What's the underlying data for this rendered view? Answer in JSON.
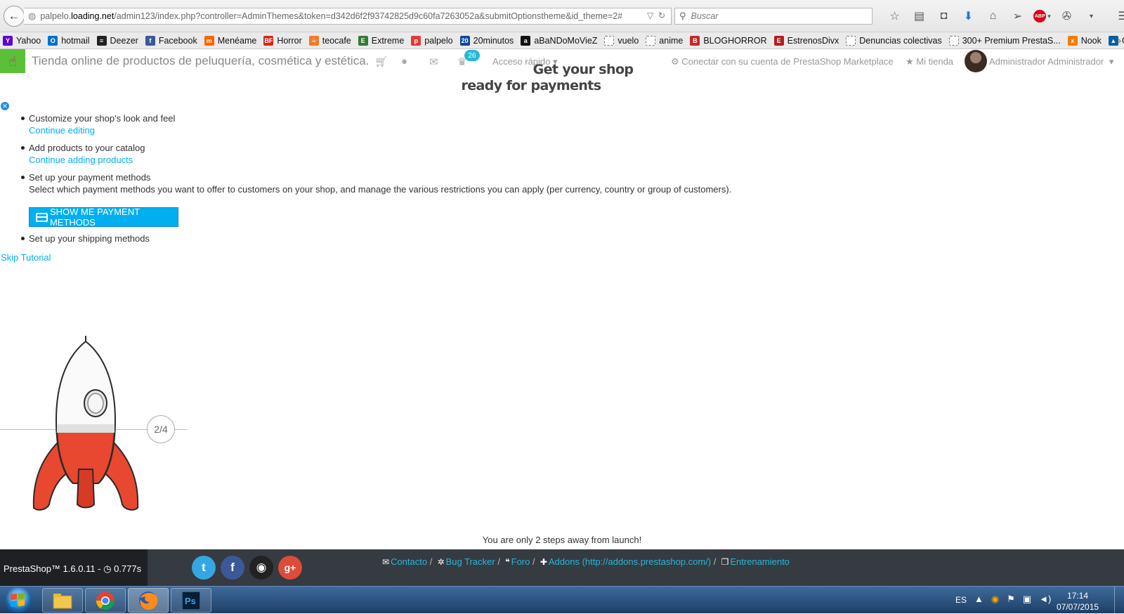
{
  "browser": {
    "url_prefix": "palpelo.",
    "url_host": "loading.net",
    "url_path": "/admin123/index.php?controller=AdminThemes&token=d342d6f2f93742825d9c60fa7263052a&submitOptionstheme&id_theme=2#",
    "search_placeholder": "Buscar"
  },
  "bookmarks": [
    {
      "label": "Yahoo",
      "icon": "yahoo-icon",
      "color": "#5f01d1",
      "glyph": "Y"
    },
    {
      "label": "hotmail",
      "icon": "outlook-icon",
      "color": "#0072c6",
      "glyph": "O"
    },
    {
      "label": "Deezer",
      "icon": "deezer-icon",
      "color": "#222222",
      "glyph": "≡"
    },
    {
      "label": "Facebook",
      "icon": "facebook-icon",
      "color": "#3b5998",
      "glyph": "f"
    },
    {
      "label": "Menéame",
      "icon": "meneame-icon",
      "color": "#ff6400",
      "glyph": "m"
    },
    {
      "label": "Horror",
      "icon": "horror-icon",
      "color": "#d9241c",
      "glyph": "BF"
    },
    {
      "label": "teocafe",
      "icon": "teocafe-icon",
      "color": "#f07a2a",
      "glyph": "☕"
    },
    {
      "label": "Extreme",
      "icon": "extreme-icon",
      "color": "#2e7d32",
      "glyph": "E"
    },
    {
      "label": "palpelo",
      "icon": "palpelo-icon",
      "color": "#e53935",
      "glyph": "p"
    },
    {
      "label": "20minutos",
      "icon": "20minutos-icon",
      "color": "#0d47a1",
      "glyph": "20"
    },
    {
      "label": "aBaNDoMoVieZ",
      "icon": "abandomoviez-icon",
      "color": "#111111",
      "glyph": "a"
    },
    {
      "label": "vuelo",
      "icon": "page-icon",
      "color": "#ffffff",
      "glyph": ""
    },
    {
      "label": "anime",
      "icon": "page-icon",
      "color": "#ffffff",
      "glyph": ""
    },
    {
      "label": "BLOGHORROR",
      "icon": "bloghorror-icon",
      "color": "#c62828",
      "glyph": "B"
    },
    {
      "label": "EstrenosDivx",
      "icon": "estrenosdivx-icon",
      "color": "#b71c1c",
      "glyph": "E"
    },
    {
      "label": "Denuncias colectivas",
      "icon": "page-icon",
      "color": "#ffffff",
      "glyph": ""
    },
    {
      "label": "300+ Premium PrestaS...",
      "icon": "page-icon",
      "color": "#ffffff",
      "glyph": ""
    },
    {
      "label": "Nook",
      "icon": "xda-icon",
      "color": "#f57c00",
      "glyph": "x"
    },
    {
      "label": "Garmin",
      "icon": "garmin-icon",
      "color": "#0060a0",
      "glyph": "▲"
    }
  ],
  "header": {
    "shop_name": "Tienda online de productos de peluquería, cosmética y estética.",
    "notification_count": "26",
    "quick_access": "Acceso rápido",
    "marketplace": "Conectar con su cuenta de PrestaShop Marketplace",
    "my_shop": "Mi tienda",
    "admin_name": "Administrador Administrador"
  },
  "onboarding": {
    "title_line1": "Get your shop",
    "title_line2": "ready for payments",
    "steps": [
      {
        "title": "Customize your shop's look and feel",
        "link": "Continue editing"
      },
      {
        "title": "Add products to your catalog",
        "link": "Continue adding products"
      },
      {
        "title": "Set up your payment methods",
        "desc": "Select which payment methods you want to offer to customers on your shop, and manage the various restrictions you can apply (per currency, country or group of customers).",
        "button": "SHOW ME PAYMENT METHODS"
      },
      {
        "title": "Set up your shipping methods"
      }
    ],
    "skip": "Skip Tutorial",
    "progress": "2/4",
    "launch_message": "You are only 2 steps away from launch!"
  },
  "footer": {
    "version": "PrestaShop™ 1.6.0.11 - ",
    "timing": "0.777s",
    "links": [
      {
        "label": "Contacto",
        "icon": "envelope-icon"
      },
      {
        "label": "Bug Tracker",
        "icon": "bug-icon"
      },
      {
        "label": "Foro",
        "icon": "comments-icon"
      },
      {
        "label": "Addons (http://addons.prestashop.com/)",
        "icon": "puzzle-icon"
      },
      {
        "label": "Entrenamiento",
        "icon": "book-icon"
      }
    ]
  },
  "taskbar": {
    "language": "ES",
    "time": "17:14",
    "date": "07/07/2015"
  }
}
